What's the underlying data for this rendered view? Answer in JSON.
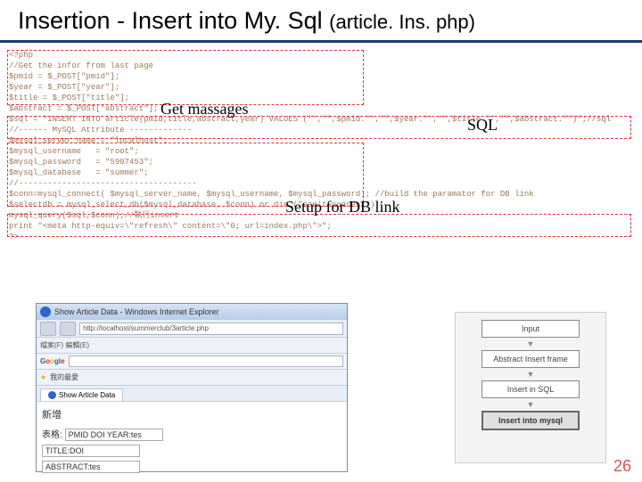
{
  "title_main": "Insertion - Insert into My. Sql ",
  "title_paren": "(article. Ins. php)",
  "code": {
    "l1": "<?php",
    "l2": "//Get the infor from last page",
    "l3": "$pmid = $_POST[\"pmid\"];",
    "l4": "$year = $_POST[\"year\"];",
    "l5": "$title = $_POST[\"title\"];",
    "l6": "$abstract = $_POST[\"abstract\"];",
    "l7": "",
    "l8": "$sql = \"INSERT INTO article(pmid,title,abstract,year) VALUES ('','\",$pmid.\"','\",$year.\"','\",$title.\"','\",$abstract.\"')\";//sql",
    "l9": "//------ MySQL Attribute -------------",
    "l10": "$mysql_server_name = \"localhost\";",
    "l11": "$mysql_username   = \"root\";",
    "l12": "$mysql_password   = \"5907453\";",
    "l13": "$mysql_database   = \"summer\";",
    "l14": "//-------------------------------------",
    "l15": "$conn=mysql_connect( $mysql_server_name, $mysql_username, $mysql_password); //build the paramator for DB link",
    "l16": "$selectdb = mysql_select_db($mysql_database, $conn) or die (\"can't connect\");",
    "l17": "",
    "l18": "mysql_query($sql,$conn);//執行insert",
    "l19": "",
    "l20": "print \"<meta http-equiv=\\\"refresh\\\" content=\\\"0; url=index.php\\\">\";",
    "l21": "?>"
  },
  "annotations": {
    "get_msg": "Get massages",
    "sql": "SQL",
    "setup": "Setup for DB link"
  },
  "browser": {
    "window_title": "Show Article Data - Windows Internet Explorer",
    "url": "http://localhost/summerclub/3article.php",
    "toolbar_items": "檔案(F)  編輯(E)",
    "fav_label": "我的最愛",
    "tab_label": "Show Article Data",
    "page_heading": "新增",
    "row1_label": "表格:",
    "row1_value": "PMID DOI YEAR:tes",
    "row2_label": "TITLE:DOI",
    "row3_label": "ABSTRACT:tes"
  },
  "flow": {
    "box1": "Input",
    "box2": "Abstract Insert frame",
    "box3": "Insert in SQL",
    "box4": "Insert into mysql"
  },
  "page_number": "26"
}
